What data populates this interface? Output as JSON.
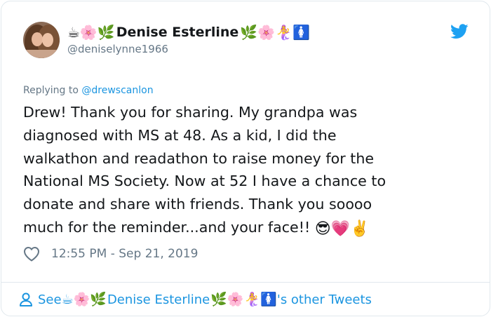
{
  "author": {
    "name_prefix_emoji": "☕🌸🌿",
    "name": "Denise Esterline",
    "name_suffix_emoji": "🌿🌸🧜‍♀️🚺",
    "handle": "@deniselynne1966",
    "avatar_icon": "profile-photo"
  },
  "reply": {
    "prefix": "Replying to ",
    "to": "@drewscanlon"
  },
  "tweet": {
    "lines": [
      "Drew! Thank you for sharing. My grandpa was",
      "diagnosed with MS at 48. As a kid, I did the",
      "walkathon and readathon to raise money for the",
      "National MS Society. Now at 52 I have a chance to",
      "donate and share with friends. Thank you soooo",
      "much for the reminder...and your face!! "
    ],
    "end_emoji": "😎💗✌️"
  },
  "meta": {
    "timestamp": "12:55 PM - Sep 21, 2019",
    "like_icon": "heart-outline-icon"
  },
  "footer": {
    "see": "See ",
    "name_prefix_emoji": "☕🌸🌿",
    "name": "Denise Esterline",
    "name_suffix_emoji": "🌿🌸🧜‍♀️🚺",
    "suffix": "'s other Tweets"
  },
  "colors": {
    "link": "#1b95e0",
    "muted": "#657786",
    "text": "#14171a",
    "border": "#e1e8ed",
    "twitter_blue": "#1da1f2"
  }
}
